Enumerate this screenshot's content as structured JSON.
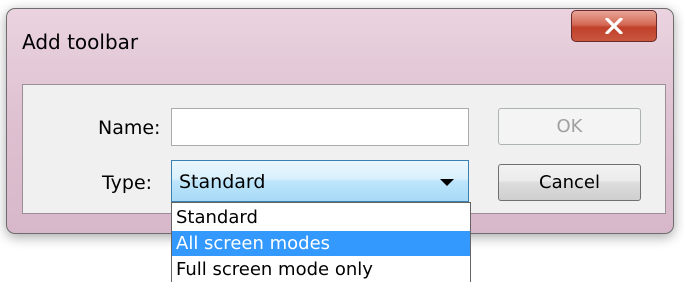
{
  "dialog": {
    "title": "Add toolbar",
    "fields": {
      "name_label": "Name:",
      "name_value": "",
      "type_label": "Type:",
      "type_value": "Standard"
    },
    "buttons": {
      "ok": "OK",
      "cancel": "Cancel"
    },
    "type_options": [
      {
        "label": "Standard",
        "selected": false
      },
      {
        "label": "All screen modes",
        "selected": true
      },
      {
        "label": "Full screen mode only",
        "selected": false
      }
    ]
  },
  "colors": {
    "highlight": "#3399ff",
    "close_button": "#c9573f"
  }
}
